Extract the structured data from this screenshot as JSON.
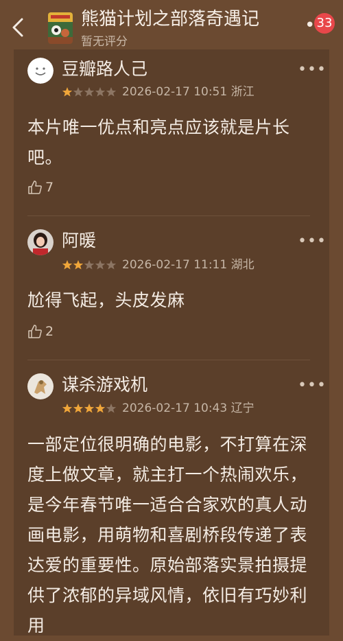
{
  "header": {
    "title": "熊猫计划之部落奇遇记",
    "subtitle": "暂无评分",
    "badge_count": "33",
    "more_label": "•••"
  },
  "colors": {
    "background": "#6b4a31",
    "panel": "#5b3f2a",
    "star_filled": "#f0a63a",
    "star_empty": "#8c7563",
    "badge": "#e8474a"
  },
  "reviews": [
    {
      "user": "豆瓣路人己",
      "rating": 1,
      "date": "2026-02-17 10:51",
      "location": "浙江",
      "text": "本片唯一优点和亮点应该就是片长吧。",
      "likes": "7"
    },
    {
      "user": "阿暖",
      "rating": 2,
      "date": "2026-02-17 11:11",
      "location": "湖北",
      "text": "尬得飞起，头皮发麻",
      "likes": "2"
    },
    {
      "user": "谋杀游戏机",
      "rating": 4,
      "date": "2026-02-17 10:43",
      "location": "辽宁",
      "text": "一部定位很明确的电影，不打算在深度上做文章，就主打一个热闹欢乐，是今年春节唯一适合合家欢的真人动画电影，用萌物和喜剧桥段传递了表达爱的重要性。原始部落实景拍摄提供了浓郁的异域风情，依旧有巧妙利用"
    }
  ]
}
